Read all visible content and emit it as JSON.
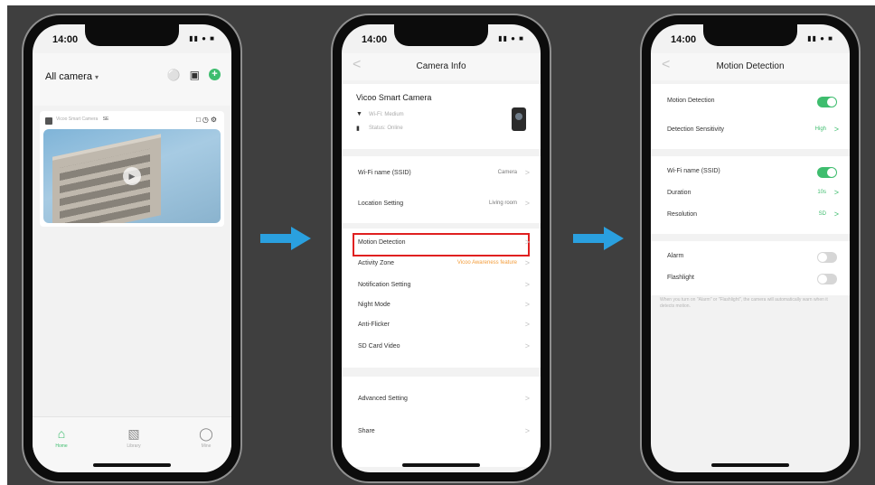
{
  "phone1": {
    "time": "14:00",
    "status_icons": "▮▮ ● ■",
    "title": "All camera",
    "title_caret": "▾",
    "card": {
      "name": "Vicoo Smart Camera",
      "tag": "SE"
    },
    "tabs": [
      {
        "icon": "⌂",
        "label": "Home"
      },
      {
        "icon": "▧",
        "label": "Library"
      },
      {
        "icon": "◯",
        "label": "Mine"
      }
    ]
  },
  "phone2": {
    "time": "14:00",
    "title": "Camera Info",
    "back": "<",
    "camera_name": "Vicoo Smart Camera",
    "wifi_info": "Wi-Fi: Medium",
    "status_info": "Status: Online",
    "rows1": [
      {
        "label": "Wi-Fi name (SSID)",
        "value": "Camera"
      },
      {
        "label": "Location Setting",
        "value": "Living room"
      }
    ],
    "rows2": [
      {
        "label": "Motion Detection",
        "value": ""
      },
      {
        "label": "Activity Zone",
        "value": "Vicoo Awareness feature"
      },
      {
        "label": "Notification Setting",
        "value": ""
      },
      {
        "label": "Night Mode",
        "value": ""
      },
      {
        "label": "Anti-Flicker",
        "value": ""
      },
      {
        "label": "SD Card Video",
        "value": ""
      }
    ],
    "rows3": [
      {
        "label": "Advanced Setting",
        "value": ""
      },
      {
        "label": "Share",
        "value": ""
      }
    ],
    "chevron": ">"
  },
  "phone3": {
    "time": "14:00",
    "title": "Motion Detection",
    "back": "<",
    "motion_detection": {
      "label": "Motion Detection",
      "on": true
    },
    "sensitivity": {
      "label": "Detection Sensitivity",
      "value": "High"
    },
    "wifi": {
      "label": "Wi-Fi name (SSID)",
      "on": true
    },
    "duration": {
      "label": "Duration",
      "value": "10s"
    },
    "resolution": {
      "label": "Resolution",
      "value": "SD"
    },
    "alarm": {
      "label": "Alarm",
      "on": false
    },
    "flashlight": {
      "label": "Flashlight",
      "on": false
    },
    "note": "When you turn on \"Alarm\" or \"Flashlight\", the camera will automatically warn when it detects motion.",
    "chevron": ">"
  },
  "colors": {
    "accent_green": "#3ebd6e",
    "arrow_blue": "#2aa0df",
    "highlight_red": "#e02020"
  }
}
